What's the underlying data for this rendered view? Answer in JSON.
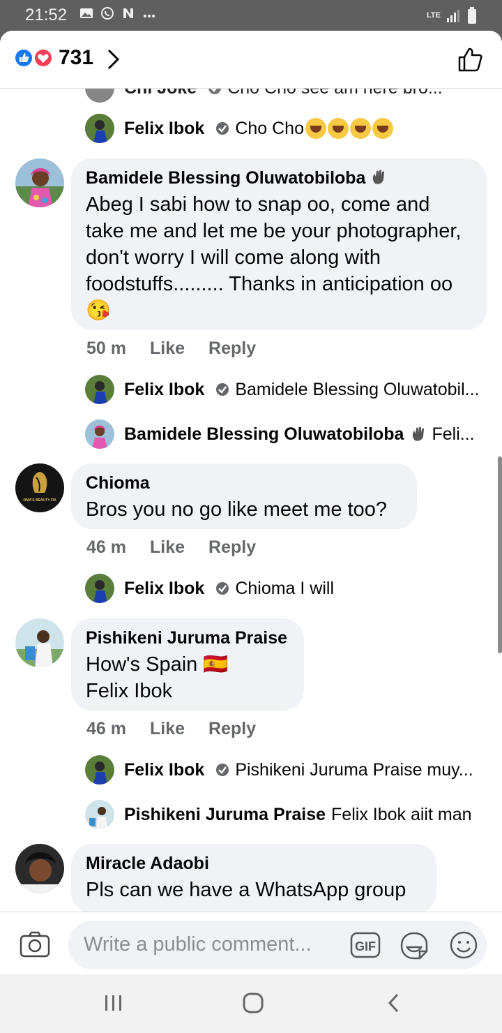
{
  "status_bar": {
    "time": "21:52",
    "icons": [
      "gallery-icon",
      "whatsapp-icon",
      "n-app-icon",
      "more-dots-icon"
    ],
    "network": "LTE",
    "right_icons": [
      "lte-icon",
      "signal-icon",
      "battery-icon"
    ]
  },
  "header": {
    "reaction_count": "731",
    "reaction_icons": [
      "like-reaction-icon",
      "love-reaction-icon"
    ],
    "like_icon": "thumbs-up-outline-icon"
  },
  "cut_top_reply": {
    "name": "Chi Joke",
    "text": "Cho Cho see am here bro..."
  },
  "replies_top": {
    "name": "Felix Ibok",
    "text": "Cho Cho"
  },
  "comments": [
    {
      "name": "Bamidele Blessing Oluwatobiloba",
      "text": "Abeg I sabi how to snap oo, come and take me and let me be your photographer, don't worry I will come along with foodstuffs......... Thanks in anticipation oo 😘",
      "time": "50 m",
      "like": "Like",
      "reply": "Reply",
      "replies": [
        {
          "name": "Felix Ibok",
          "text": "Bamidele Blessing Oluwatobil..."
        },
        {
          "name": "Bamidele Blessing Oluwatobiloba",
          "text": "Feli..."
        }
      ]
    },
    {
      "name": "Chioma",
      "text": "Bros you no go like meet me too?",
      "time": "46 m",
      "like": "Like",
      "reply": "Reply",
      "avatar_text": "OMA'S BEAUTY FIX",
      "replies": [
        {
          "name": "Felix Ibok",
          "text": "Chioma  I will"
        }
      ]
    },
    {
      "name": "Pishikeni Juruma Praise",
      "text_line1": "How's Spain 🇪🇸",
      "text_line2": "Felix Ibok",
      "time": "46 m",
      "like": "Like",
      "reply": "Reply",
      "replies": [
        {
          "name": "Felix Ibok",
          "text": "Pishikeni Juruma Praise muy..."
        },
        {
          "name": "Pishikeni Juruma Praise",
          "text": "Felix Ibok aiit man"
        }
      ]
    },
    {
      "name": "Miracle Adaobi",
      "text": "Pls can we have a WhatsApp group"
    }
  ],
  "composer": {
    "placeholder": "Write a public comment...",
    "camera_icon": "camera-icon",
    "gif_label": "GIF",
    "sticker_icon": "sticker-icon",
    "emoji_icon": "emoji-icon"
  },
  "nav": {
    "icons": [
      "recents-icon",
      "home-icon",
      "back-icon"
    ]
  },
  "colors": {
    "like_blue": "#1877f2",
    "love_red": "#f33e58",
    "bubble": "#f0f2f5",
    "meta_gray": "#65676b"
  }
}
